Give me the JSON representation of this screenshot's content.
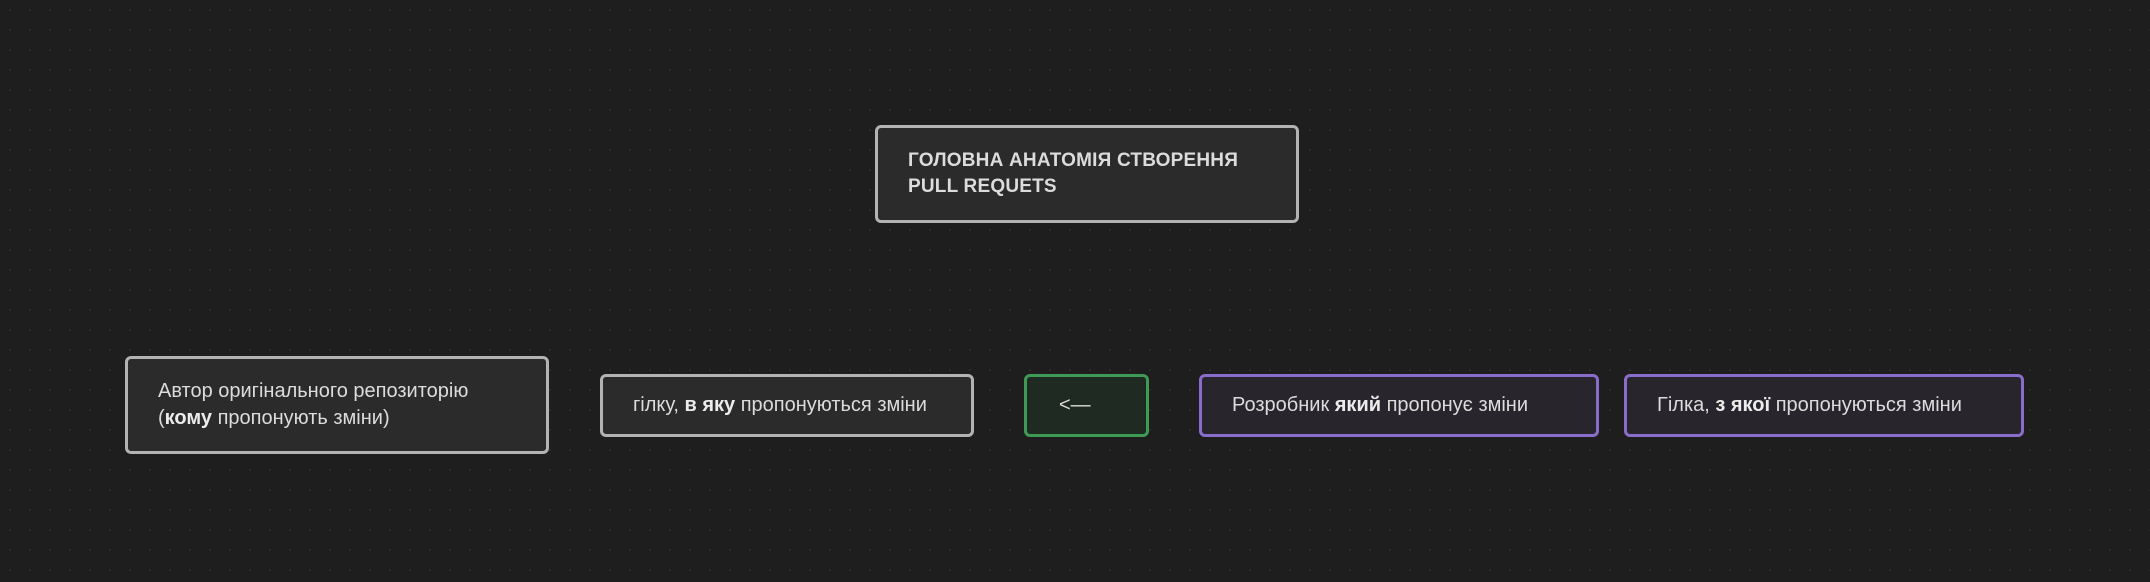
{
  "nodes": {
    "title": {
      "line1": "ГОЛОВНА АНАТОМІЯ СТВОРЕННЯ",
      "line2": "PULL REQUETS"
    },
    "owner": {
      "line1": "Автор оригінального репозиторію",
      "line2_prefix": "(",
      "line2_bold": "кому",
      "line2_suffix": " пропонують зміни)"
    },
    "target_branch": {
      "prefix": "гілку, ",
      "bold": "в яку",
      "suffix": " пропонуються зміни"
    },
    "arrow": {
      "label": "<—"
    },
    "developer": {
      "prefix": "Розробник ",
      "bold": "який",
      "suffix": " пропонує зміни"
    },
    "source_branch": {
      "prefix": "Гілка, ",
      "bold": "з якої",
      "suffix": " пропонуються зміни"
    }
  },
  "colors": {
    "background": "#1e1e1e",
    "neutral_border": "#b3b3b3",
    "green_border": "#3e9a55",
    "purple_border": "#8a6ccb"
  }
}
